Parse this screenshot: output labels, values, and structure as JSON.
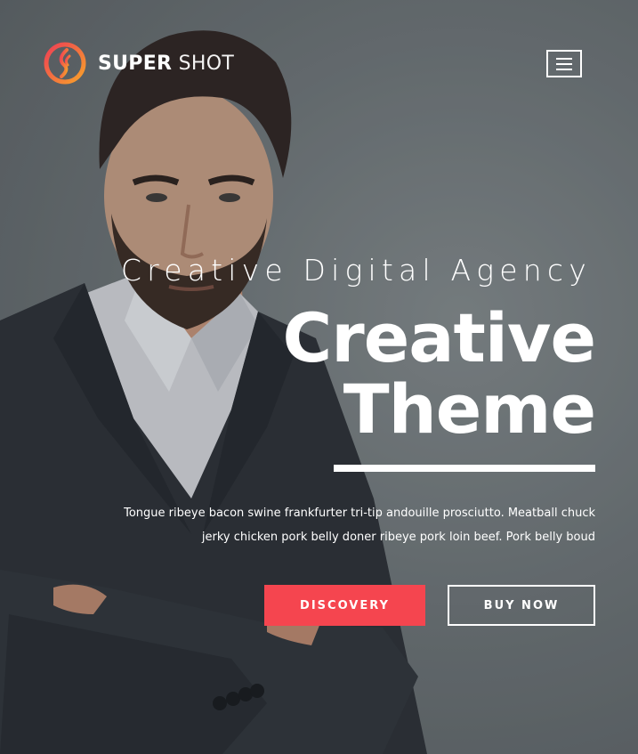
{
  "brand": {
    "name_bold": "SUPER",
    "name_light": "SHOT",
    "logo_icon": "flame-circle-logo",
    "logo_colors": [
      "#f7a12a",
      "#ef3f55"
    ]
  },
  "header": {
    "menu_icon": "hamburger-menu-icon"
  },
  "hero": {
    "subtitle": "Creative Digital Agency",
    "title_line1": "Creative",
    "title_line2": "Theme",
    "description": "Tongue ribeye bacon swine frankfurter tri-tip andouille prosciutto. Meatball chuck jerky chicken pork belly doner ribeye pork loin beef. Pork belly boud",
    "primary_button": "DISCOVERY",
    "secondary_button": "BUY NOW"
  },
  "colors": {
    "accent": "#f5454f",
    "text": "#ffffff",
    "background": "#6f7679"
  }
}
